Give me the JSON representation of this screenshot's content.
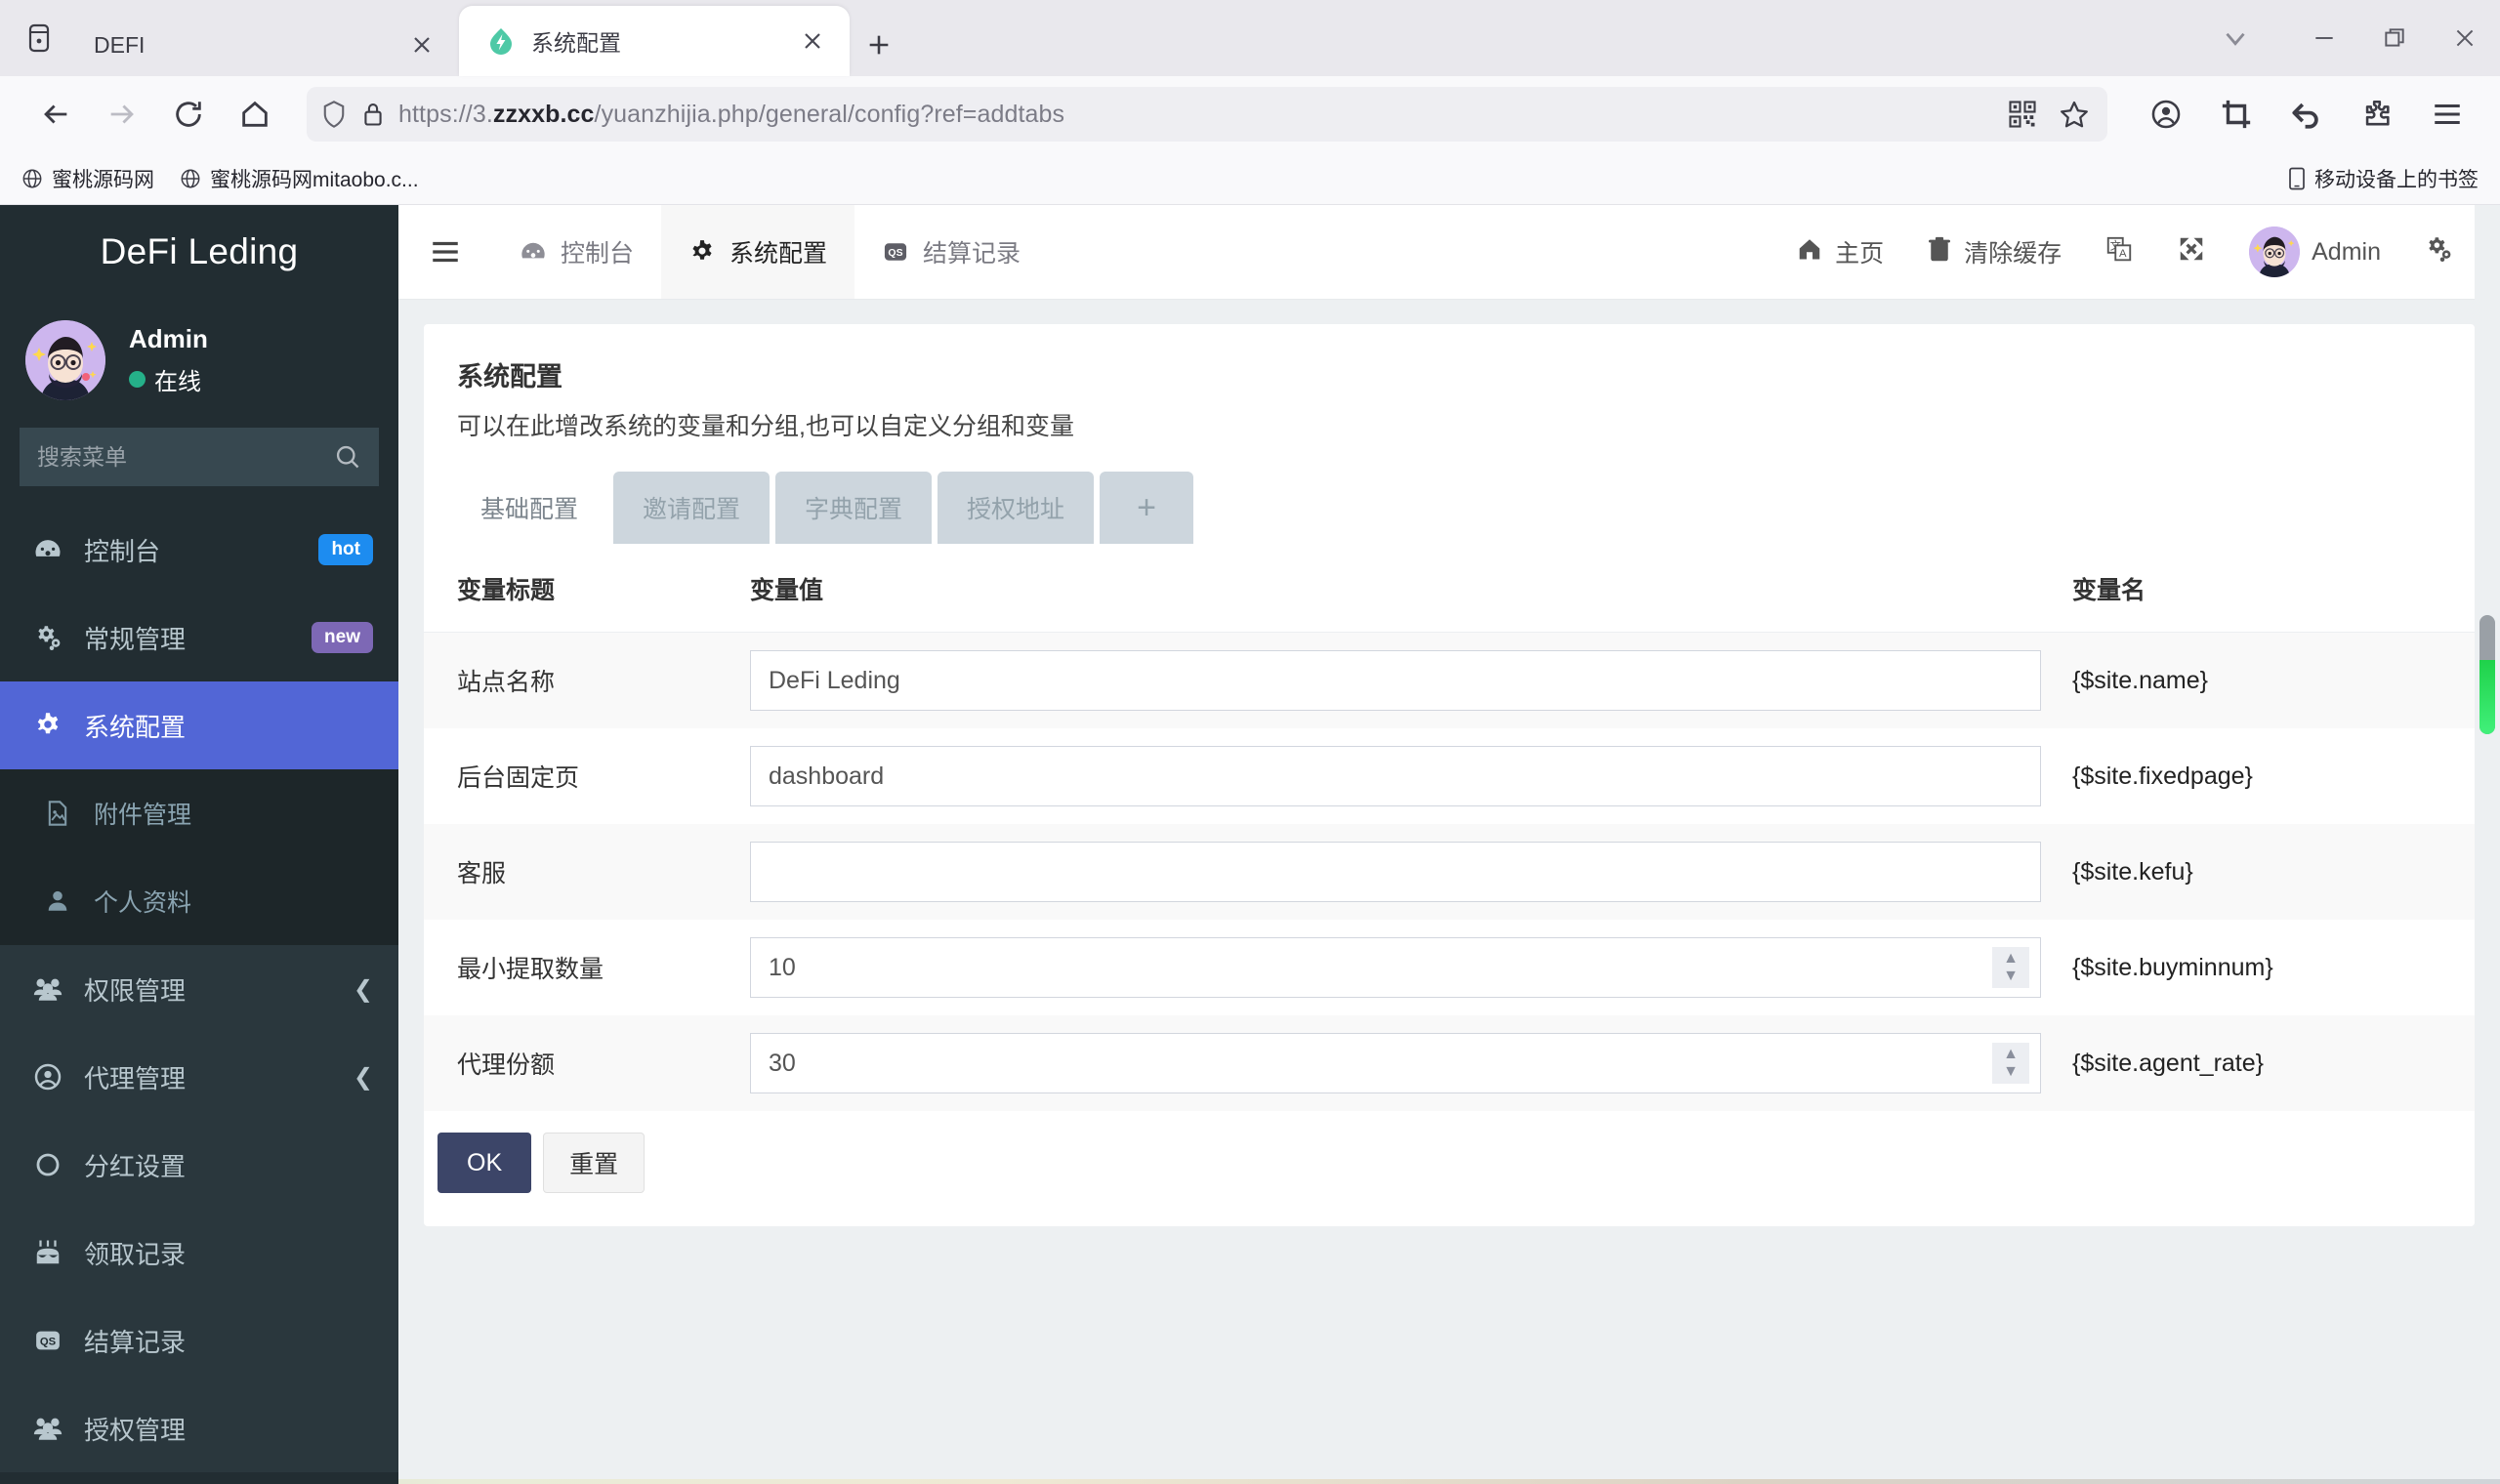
{
  "browser": {
    "tabs": [
      {
        "title": "DEFI",
        "active": false,
        "favicon": "none"
      },
      {
        "title": "系统配置",
        "active": true,
        "favicon": "bolt-droplet-icon"
      }
    ],
    "new_tab_label": "+",
    "window_controls": {
      "chevron": "⌄",
      "minimize": "—",
      "maximize": "❐",
      "close": "✕"
    },
    "url": {
      "prefix": "https://3.",
      "host": "zzxxb.cc",
      "path": "/yuanzhijia.php/general/config?ref=addtabs"
    },
    "nav": {
      "back": "←",
      "forward": "→",
      "reload": "⟳",
      "home": "⌂"
    },
    "bookmarks": [
      {
        "label": "蜜桃源码网"
      },
      {
        "label": "蜜桃源码网mitaobo.c..."
      }
    ],
    "bookmarks_right": {
      "label": "移动设备上的书签"
    }
  },
  "sidebar": {
    "brand": "DeFi Leding",
    "user": {
      "name": "Admin",
      "status": "在线"
    },
    "search": {
      "placeholder": "搜索菜单",
      "value": ""
    },
    "items": [
      {
        "label": "控制台",
        "icon": "dashboard-icon",
        "badge": "hot",
        "badge_kind": "hot",
        "state": "normal"
      },
      {
        "label": "常规管理",
        "icon": "gears-icon",
        "badge": "new",
        "badge_kind": "new",
        "state": "normal"
      },
      {
        "label": "系统配置",
        "icon": "gear-icon",
        "badge": "",
        "state": "active"
      },
      {
        "label": "附件管理",
        "icon": "image-file-icon",
        "badge": "",
        "state": "sub"
      },
      {
        "label": "个人资料",
        "icon": "user-icon",
        "badge": "",
        "state": "sub"
      },
      {
        "label": "权限管理",
        "icon": "users-icon",
        "badge": "",
        "state": "group",
        "chevron": "❮"
      },
      {
        "label": "代理管理",
        "icon": "user-circle-icon",
        "badge": "",
        "state": "group",
        "chevron": "❮"
      },
      {
        "label": "分红设置",
        "icon": "circle-icon",
        "badge": "",
        "state": "group"
      },
      {
        "label": "领取记录",
        "icon": "cake-icon",
        "badge": "",
        "state": "group"
      },
      {
        "label": "结算记录",
        "icon": "qs-icon",
        "badge": "",
        "state": "group"
      },
      {
        "label": "授权管理",
        "icon": "users-icon",
        "badge": "",
        "state": "group"
      }
    ]
  },
  "topnav": {
    "hamburger": "☰",
    "tabs": [
      {
        "label": "控制台",
        "icon": "dashboard-icon",
        "active": false
      },
      {
        "label": "系统配置",
        "icon": "gear-icon",
        "active": true
      },
      {
        "label": "结算记录",
        "icon": "qs-icon",
        "active": false
      }
    ],
    "right": [
      {
        "label": "主页",
        "icon": "home-icon"
      },
      {
        "label": "清除缓存",
        "icon": "trash-icon"
      },
      {
        "label": "",
        "icon": "language-icon"
      },
      {
        "label": "",
        "icon": "fullscreen-icon"
      },
      {
        "label": "Admin",
        "icon": "avatar"
      },
      {
        "label": "",
        "icon": "settings-gears-icon"
      }
    ]
  },
  "page": {
    "title": "系统配置",
    "subtitle": "可以在此增改系统的变量和分组,也可以自定义分组和变量",
    "tabs": [
      {
        "label": "基础配置",
        "active": true
      },
      {
        "label": "邀请配置",
        "active": false
      },
      {
        "label": "字典配置",
        "active": false
      },
      {
        "label": "授权地址",
        "active": false
      },
      {
        "label": "+",
        "active": false,
        "kind": "add"
      }
    ],
    "table": {
      "headers": [
        "变量标题",
        "变量值",
        "变量名"
      ],
      "rows": [
        {
          "title": "站点名称",
          "value": "DeFi Leding",
          "placeholder": "",
          "name": "{$site.name}",
          "type": "text"
        },
        {
          "title": "后台固定页",
          "value": "dashboard",
          "placeholder": "",
          "name": "{$site.fixedpage}",
          "type": "text"
        },
        {
          "title": "客服",
          "value": "",
          "placeholder": "",
          "name": "{$site.kefu}",
          "type": "text"
        },
        {
          "title": "最小提取数量",
          "value": "10",
          "placeholder": "",
          "name": "{$site.buyminnum}",
          "type": "number"
        },
        {
          "title": "代理份额",
          "value": "30",
          "placeholder": "",
          "name": "{$site.agent_rate}",
          "type": "number"
        }
      ]
    },
    "buttons": {
      "ok": "OK",
      "reset": "重置"
    }
  },
  "colors": {
    "sidebar_bg": "#222d32",
    "active_item": "#5266d6",
    "badge_hot": "#1d8cf0",
    "badge_new": "#7d68b5",
    "ok_button": "#3c4568",
    "online_dot": "#25b089",
    "scroll_thumb_green": "#2fe05c"
  }
}
